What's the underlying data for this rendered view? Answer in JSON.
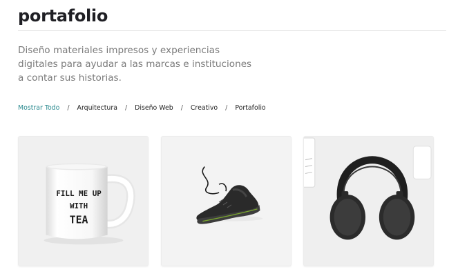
{
  "header": {
    "title": "portafolio"
  },
  "intro": {
    "text": "Diseño materiales impresos y experiencias digitales para ayudar a las marcas e instituciones a contar sus historias."
  },
  "filters": {
    "items": [
      {
        "label": "Mostrar Todo",
        "active": true
      },
      {
        "label": "Arquitectura",
        "active": false
      },
      {
        "label": "Diseño Web",
        "active": false
      },
      {
        "label": "Creativo",
        "active": false
      },
      {
        "label": "Portafolio",
        "active": false
      }
    ],
    "separator": "/",
    "active_color": "#2a8a8f"
  },
  "portfolio": {
    "items": [
      {
        "image": "coffee-mug",
        "mug_text": [
          "FILL ME UP",
          "WITH",
          "TEA"
        ]
      },
      {
        "image": "sneaker"
      },
      {
        "image": "headphones"
      }
    ]
  }
}
